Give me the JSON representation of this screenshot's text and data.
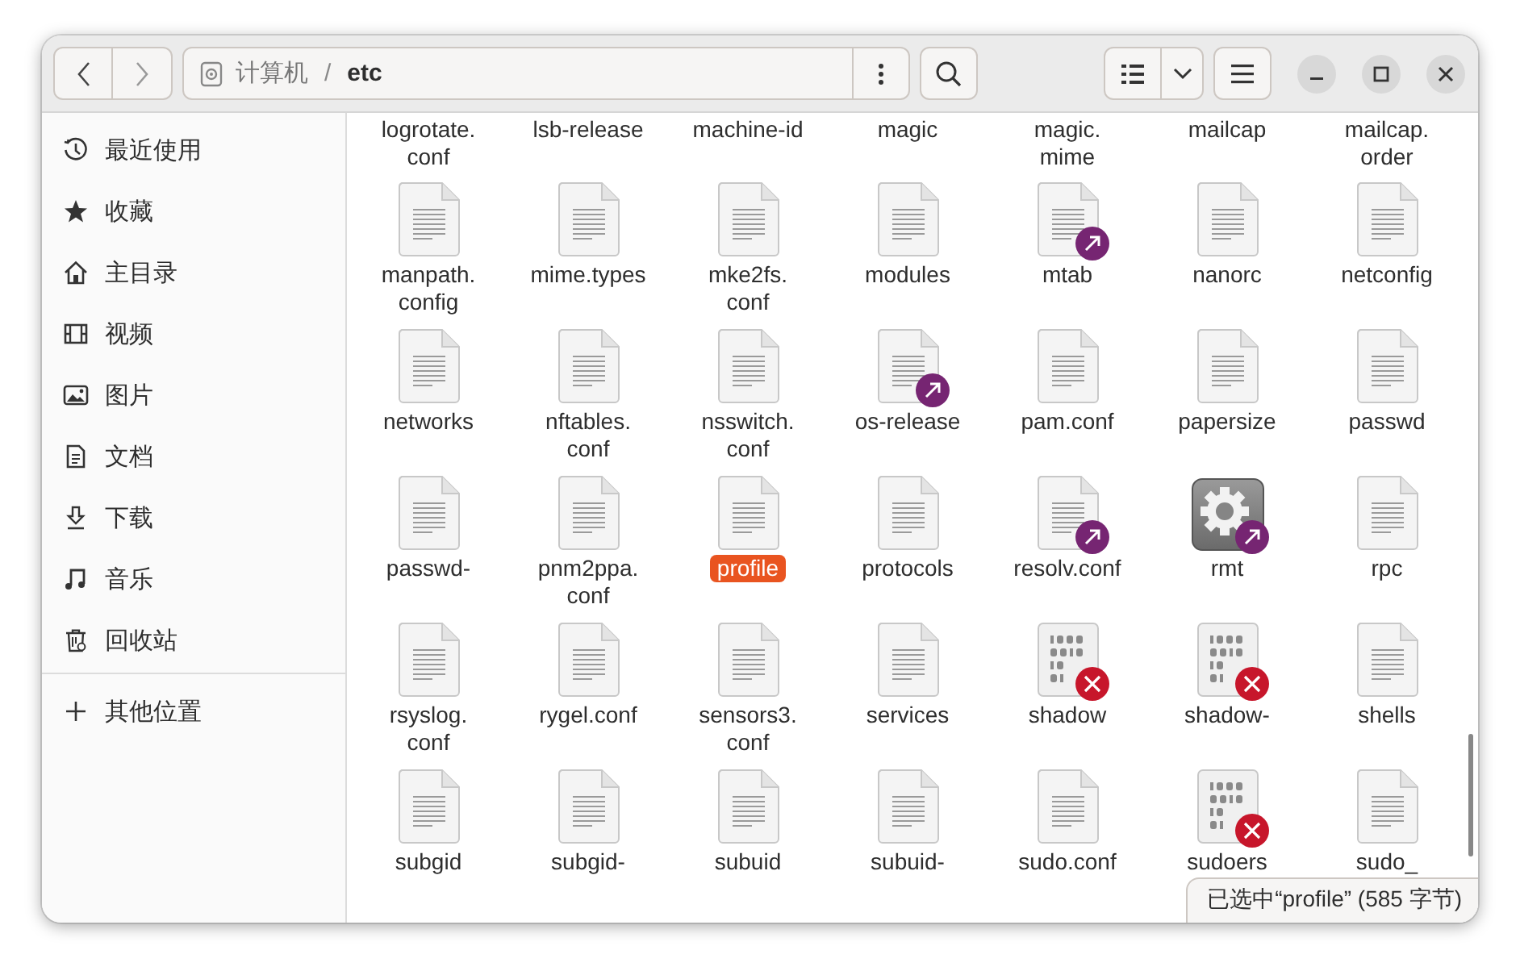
{
  "header": {
    "path": [
      {
        "label": "计算机",
        "kind": "drive",
        "selected": false
      },
      {
        "label": "etc",
        "kind": "folder",
        "selected": true
      }
    ],
    "separator": "/"
  },
  "sidebar": {
    "items": [
      {
        "label": "最近使用",
        "kind": "recent",
        "selected": false
      },
      {
        "label": "收藏",
        "kind": "starred",
        "selected": false
      },
      {
        "label": "主目录",
        "kind": "home",
        "selected": false
      },
      {
        "label": "视频",
        "kind": "videos",
        "selected": false
      },
      {
        "label": "图片",
        "kind": "pictures",
        "selected": false
      },
      {
        "label": "文档",
        "kind": "documents",
        "selected": false
      },
      {
        "label": "下载",
        "kind": "downloads",
        "selected": false
      },
      {
        "label": "音乐",
        "kind": "music",
        "selected": false
      },
      {
        "label": "回收站",
        "kind": "trash",
        "selected": false
      }
    ],
    "other": {
      "label": "其他位置",
      "kind": "other",
      "selected": false
    }
  },
  "grid": {
    "rows": [
      {
        "clipped_top": true,
        "items": [
          {
            "label": "logrotate.\nconf",
            "selected": false
          },
          {
            "label": "lsb-release",
            "selected": false
          },
          {
            "label": "machine-id",
            "selected": false
          },
          {
            "label": "magic",
            "selected": false
          },
          {
            "label": "magic.\nmime",
            "selected": false
          },
          {
            "label": "mailcap",
            "selected": false
          },
          {
            "label": "mailcap.\norder",
            "selected": false
          }
        ]
      },
      {
        "clipped_top": false,
        "items": [
          {
            "label": "manpath.\nconfig",
            "kind": "text",
            "symlink": false,
            "locked": false,
            "selected": false
          },
          {
            "label": "mime.types",
            "kind": "text",
            "symlink": false,
            "locked": false,
            "selected": false
          },
          {
            "label": "mke2fs.\nconf",
            "kind": "text",
            "symlink": false,
            "locked": false,
            "selected": false
          },
          {
            "label": "modules",
            "kind": "text",
            "symlink": false,
            "locked": false,
            "selected": false
          },
          {
            "label": "mtab",
            "kind": "text",
            "symlink": true,
            "locked": false,
            "selected": false
          },
          {
            "label": "nanorc",
            "kind": "text",
            "symlink": false,
            "locked": false,
            "selected": false
          },
          {
            "label": "netconfig",
            "kind": "text",
            "symlink": false,
            "locked": false,
            "selected": false
          }
        ]
      },
      {
        "clipped_top": false,
        "items": [
          {
            "label": "networks",
            "kind": "text",
            "symlink": false,
            "locked": false,
            "selected": false
          },
          {
            "label": "nftables.\nconf",
            "kind": "text",
            "symlink": false,
            "locked": false,
            "selected": false
          },
          {
            "label": "nsswitch.\nconf",
            "kind": "text",
            "symlink": false,
            "locked": false,
            "selected": false
          },
          {
            "label": "os-release",
            "kind": "text",
            "symlink": true,
            "locked": false,
            "selected": false
          },
          {
            "label": "pam.conf",
            "kind": "text",
            "symlink": false,
            "locked": false,
            "selected": false
          },
          {
            "label": "papersize",
            "kind": "text",
            "symlink": false,
            "locked": false,
            "selected": false
          },
          {
            "label": "passwd",
            "kind": "text",
            "symlink": false,
            "locked": false,
            "selected": false
          }
        ]
      },
      {
        "clipped_top": false,
        "items": [
          {
            "label": "passwd-",
            "kind": "text",
            "symlink": false,
            "locked": false,
            "selected": false
          },
          {
            "label": "pnm2ppa.\nconf",
            "kind": "text",
            "symlink": false,
            "locked": false,
            "selected": false
          },
          {
            "label": "profile",
            "kind": "text",
            "symlink": false,
            "locked": false,
            "selected": true
          },
          {
            "label": "protocols",
            "kind": "text",
            "symlink": false,
            "locked": false,
            "selected": false
          },
          {
            "label": "resolv.conf",
            "kind": "text",
            "symlink": true,
            "locked": false,
            "selected": false
          },
          {
            "label": "rmt",
            "kind": "executable",
            "symlink": true,
            "locked": false,
            "selected": false
          },
          {
            "label": "rpc",
            "kind": "text",
            "symlink": false,
            "locked": false,
            "selected": false
          }
        ]
      },
      {
        "clipped_top": false,
        "items": [
          {
            "label": "rsyslog.\nconf",
            "kind": "text",
            "symlink": false,
            "locked": false,
            "selected": false
          },
          {
            "label": "rygel.conf",
            "kind": "text",
            "symlink": false,
            "locked": false,
            "selected": false
          },
          {
            "label": "sensors3.\nconf",
            "kind": "text",
            "symlink": false,
            "locked": false,
            "selected": false
          },
          {
            "label": "services",
            "kind": "text",
            "symlink": false,
            "locked": false,
            "selected": false
          },
          {
            "label": "shadow",
            "kind": "binary",
            "symlink": false,
            "locked": true,
            "selected": false
          },
          {
            "label": "shadow-",
            "kind": "binary",
            "symlink": false,
            "locked": true,
            "selected": false
          },
          {
            "label": "shells",
            "kind": "text",
            "symlink": false,
            "locked": false,
            "selected": false
          }
        ]
      },
      {
        "clipped_top": false,
        "items": [
          {
            "label": "subgid",
            "kind": "text",
            "symlink": false,
            "locked": false,
            "selected": false
          },
          {
            "label": "subgid-",
            "kind": "text",
            "symlink": false,
            "locked": false,
            "selected": false
          },
          {
            "label": "subuid",
            "kind": "text",
            "symlink": false,
            "locked": false,
            "selected": false
          },
          {
            "label": "subuid-",
            "kind": "text",
            "symlink": false,
            "locked": false,
            "selected": false
          },
          {
            "label": "sudo.conf",
            "kind": "text",
            "symlink": false,
            "locked": false,
            "selected": false
          },
          {
            "label": "sudoers",
            "kind": "binary",
            "symlink": false,
            "locked": true,
            "selected": false
          },
          {
            "label": "sudo_",
            "kind": "text",
            "symlink": false,
            "locked": false,
            "selected": false
          }
        ]
      }
    ]
  },
  "status": "已选中“profile” (585 字节)"
}
